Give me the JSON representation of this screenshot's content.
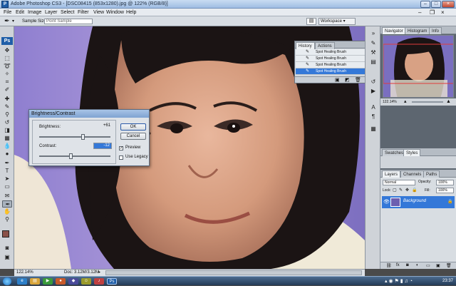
{
  "window": {
    "title": "Adobe Photoshop CS3 - [DSC08415 (853x1280).jpg @ 122% (RGB/8)]",
    "app_badge": "Ps",
    "minimize": "–",
    "maximize": "□",
    "close": "×"
  },
  "menu": [
    "File",
    "Edit",
    "Image",
    "Layer",
    "Select",
    "Filter",
    "View",
    "Window",
    "Help"
  ],
  "options": {
    "sample_size_label": "Sample Size:",
    "sample_size_value": "Point Sample",
    "workspace_label": "Workspace ▾"
  },
  "toolbox": {
    "badge": "Ps"
  },
  "status": {
    "zoom": "122.14%",
    "doc": "Doc: 3.12M/3.12M"
  },
  "history": {
    "tabs": [
      "History",
      "Actions"
    ],
    "rows": [
      {
        "label": "Spot Healing Brush",
        "selected": false
      },
      {
        "label": "Spot Healing Brush",
        "selected": false
      },
      {
        "label": "Spot Healing Brush",
        "selected": false
      },
      {
        "label": "Spot Healing Brush",
        "selected": true
      }
    ]
  },
  "brightness_contrast": {
    "title": "Brightness/Contrast",
    "brightness_label": "Brightness:",
    "brightness_value": "+61",
    "contrast_label": "Contrast:",
    "contrast_value": "-12",
    "ok_label": "OK",
    "cancel_label": "Cancel",
    "preview_label": "Preview",
    "preview_checked": true,
    "legacy_label": "Use Legacy",
    "legacy_checked": false,
    "brightness_level": 0.62,
    "contrast_level": 0.45
  },
  "navigator": {
    "tabs": [
      "Navigator",
      "Histogram",
      "Info"
    ],
    "zoom": "122.14%"
  },
  "swatches": {
    "tabs": [
      "Swatches",
      "Styles"
    ]
  },
  "layers": {
    "tabs": [
      "Layers",
      "Channels",
      "Paths"
    ],
    "blend_mode": "Normal",
    "opacity_label": "Opacity:",
    "opacity_value": "100%",
    "lock_label": "Lock:",
    "fill_label": "Fill:",
    "fill_value": "100%",
    "layer_name": "Background"
  },
  "taskbar": {
    "clock": "23:37"
  },
  "colors": {
    "accent": "#3478d8",
    "canvas_bg": "#9b84c6"
  }
}
